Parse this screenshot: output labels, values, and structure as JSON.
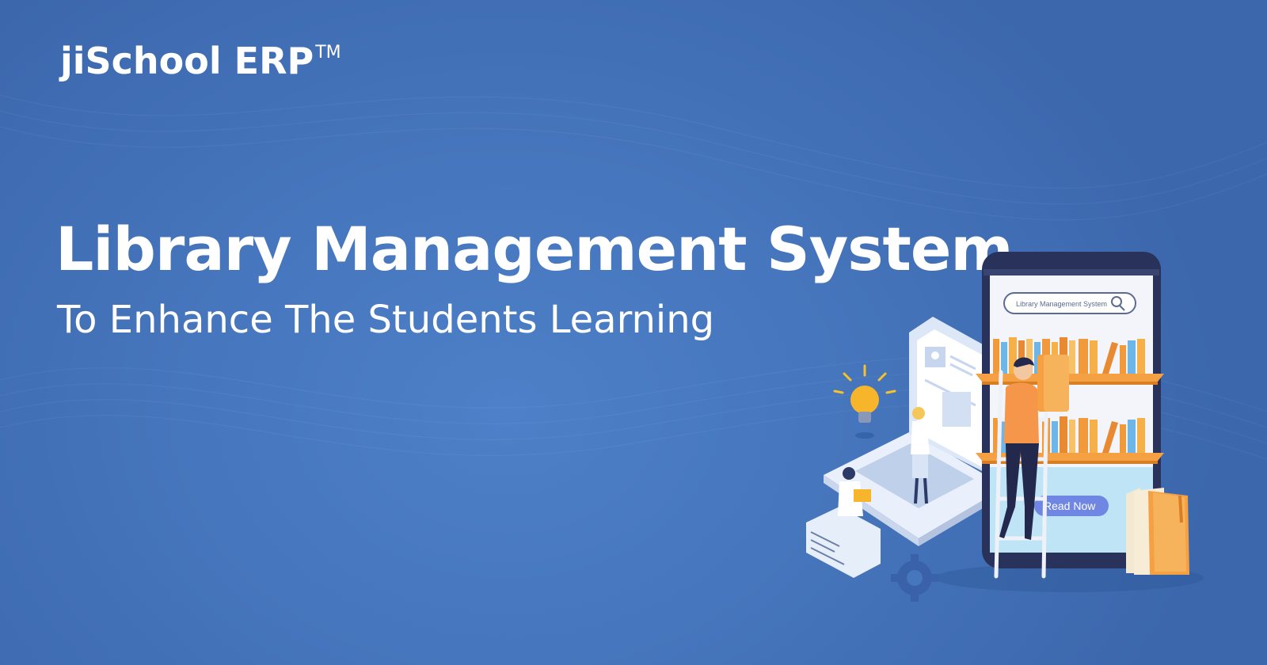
{
  "brand": {
    "name": "jiSchool ERP",
    "trademark": "TM"
  },
  "headline": {
    "title": "Library Management System",
    "subtitle": "To Enhance The Students Learning"
  },
  "illustration": {
    "search_text": "Library Management System",
    "button_label": "Read Now",
    "icons": [
      "lightbulb-icon",
      "search-icon",
      "gear-icon",
      "user-profile-icon"
    ]
  },
  "colors": {
    "background": "#4676bd",
    "accent_orange": "#f5a042",
    "text": "#ffffff"
  }
}
